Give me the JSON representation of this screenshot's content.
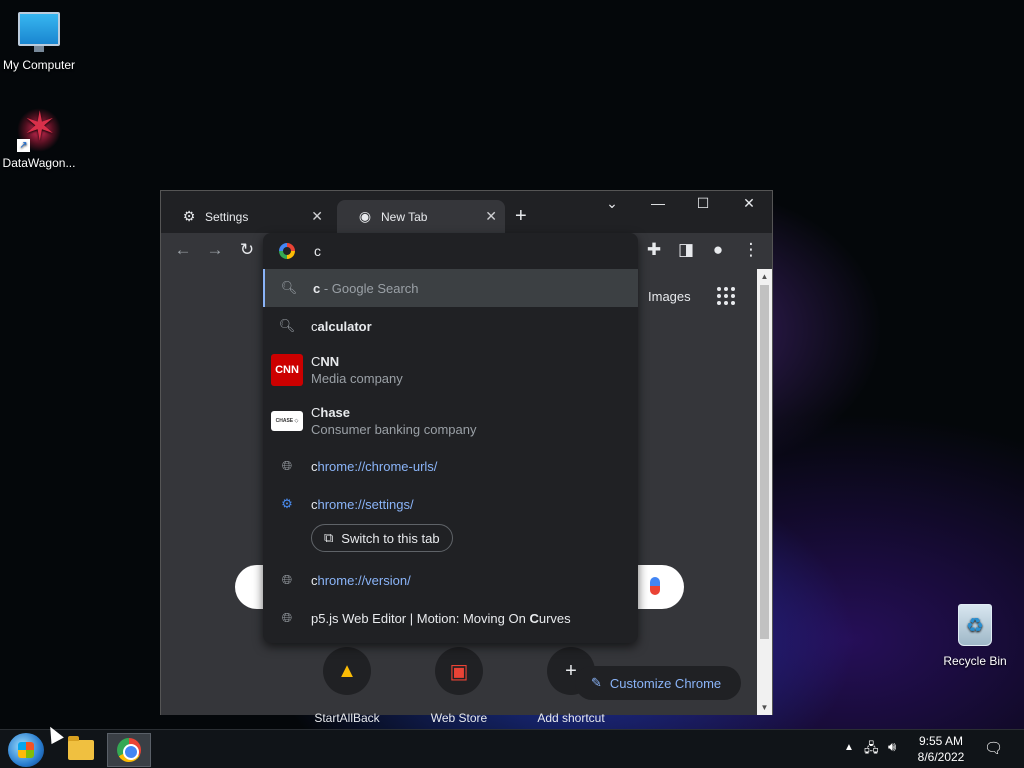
{
  "desktop": {
    "icons": [
      {
        "label": "My Computer"
      },
      {
        "label": "DataWagon..."
      },
      {
        "label": "Recycle Bin"
      }
    ]
  },
  "browser": {
    "tabs": [
      {
        "label": "Settings",
        "icon": "gear-icon"
      },
      {
        "label": "New Tab",
        "icon": "chrome-icon"
      }
    ],
    "new_tab_symbol": "+",
    "omnibox_value": "c",
    "ntp": {
      "images_link": "Images",
      "shortcuts": [
        {
          "label": "StartAllBack",
          "icon": "drive-icon"
        },
        {
          "label": "Web Store",
          "icon": "web-store-icon"
        },
        {
          "label": "Add shortcut",
          "icon": "plus-icon"
        }
      ],
      "customize_label": "Customize Chrome"
    },
    "suggestions": {
      "search": {
        "typed": "c",
        "rest": " - Google Search"
      },
      "calculator": {
        "bold": "c",
        "rest": "alculator"
      },
      "cnn": {
        "title_bold": "C",
        "title_rest": "NN",
        "subtitle": "Media company",
        "logo": "CNN"
      },
      "chase": {
        "title_bold": "C",
        "title_rest": "hase",
        "subtitle": "Consumer banking company",
        "logo": "CHASE ◇"
      },
      "chrome_urls": {
        "bold": "c",
        "rest": "hrome://chrome-urls/"
      },
      "chrome_settings": {
        "bold": "c",
        "rest": "hrome://settings/"
      },
      "switch_tab": "Switch to this tab",
      "chrome_version": {
        "bold": "c",
        "rest": "hrome://version/"
      },
      "p5": {
        "part1": "p5.js Web Editor | Motion: Moving On ",
        "bold": "C",
        "part2": "urves"
      }
    }
  },
  "taskbar": {
    "time": "9:55 AM",
    "date": "8/6/2022"
  }
}
